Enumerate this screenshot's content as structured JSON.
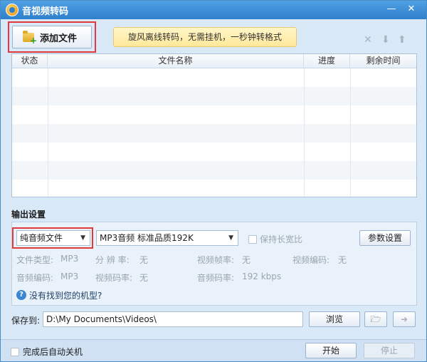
{
  "window": {
    "title": "音视频转码",
    "minimize_glyph": "—",
    "close_glyph": "✕"
  },
  "toolbar": {
    "add_file_label": "添加文件",
    "promo_text": "旋风离线转码，无需挂机，一秒钟转格式",
    "remove_glyph": "✕",
    "move_down_glyph": "⬇",
    "move_up_glyph": "⬆"
  },
  "file_table": {
    "columns": [
      "状态",
      "文件名称",
      "进度",
      "剩余时间"
    ],
    "rows": []
  },
  "output": {
    "section_label": "输出设置",
    "type_value": "纯音频文件",
    "quality_value": "MP3音频 标准品质192K",
    "keep_ratio_label": "保持长宽比",
    "params_button": "参数设置",
    "info": {
      "file_type_label": "文件类型:",
      "file_type_value": "MP3",
      "resolution_label": "分 辨 率:",
      "resolution_value": "无",
      "video_fps_label": "视频帧率:",
      "video_fps_value": "无",
      "video_codec_label": "视频编码:",
      "video_codec_value": "无",
      "audio_codec_label": "音频编码:",
      "audio_codec_value": "MP3",
      "video_bitrate_label": "视频码率:",
      "video_bitrate_value": "无",
      "audio_bitrate_label": "音频码率:",
      "audio_bitrate_value": "192 kbps"
    },
    "help_glyph": "?",
    "help_text": "没有找到您的机型?"
  },
  "save": {
    "label": "保存到:",
    "path": "D:\\My Documents\\Videos\\",
    "browse_button": "浏览"
  },
  "bottom": {
    "auto_shutdown_label": "完成后自动关机",
    "start_button": "开始",
    "stop_button": "停止"
  },
  "colors": {
    "accent": "#2f7fcc",
    "highlight_frame": "#e23a3a",
    "promo_bg": "#ffe89a",
    "panel_bg": "#e9f2fb"
  }
}
